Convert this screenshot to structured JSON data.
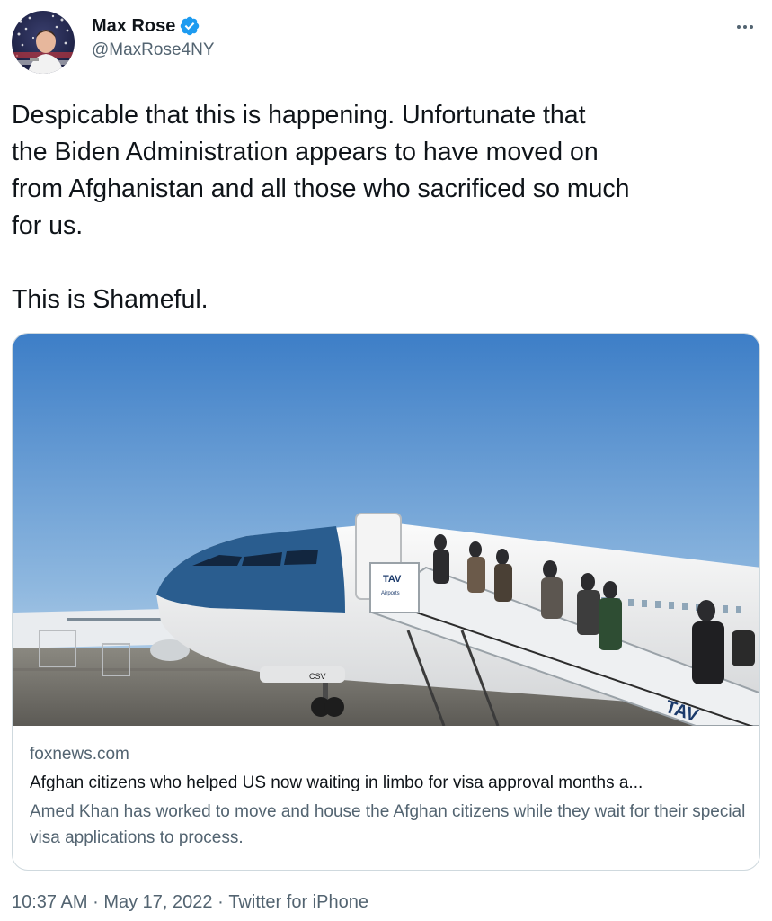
{
  "tweet": {
    "author": {
      "display_name": "Max Rose",
      "handle": "@MaxRose4NY",
      "verified": true,
      "avatar_icon": "avatar-photo"
    },
    "more_icon": "more-horizontal-icon",
    "text_lines": [
      "Despicable that this is happening. Unfortunate that",
      "the Biden Administration appears to have moved on",
      "from Afghanistan and all those who sacrificed so much",
      "for us.",
      "",
      "This is Shameful."
    ],
    "card": {
      "domain": "foxnews.com",
      "title": "Afghan citizens who helped US now waiting in limbo for visa approval months a...",
      "description": "Amed Khan has worked to move and house the Afghan citizens while they wait for their special visa applications to process.",
      "image_icon": "airplane-boarding-photo",
      "image_text": {
        "stair_sign": "TAV",
        "stair_sign_sub": "Airports",
        "nose_code": "CSV",
        "stair_logo": "TAV"
      }
    },
    "footer": {
      "time": "10:37 AM",
      "separator": "·",
      "date": "May 17, 2022",
      "source": "Twitter for iPhone"
    }
  },
  "colors": {
    "text_primary": "#0f1419",
    "text_secondary": "#536471",
    "verified_blue": "#1d9bf0",
    "card_border": "#cfd9de"
  }
}
